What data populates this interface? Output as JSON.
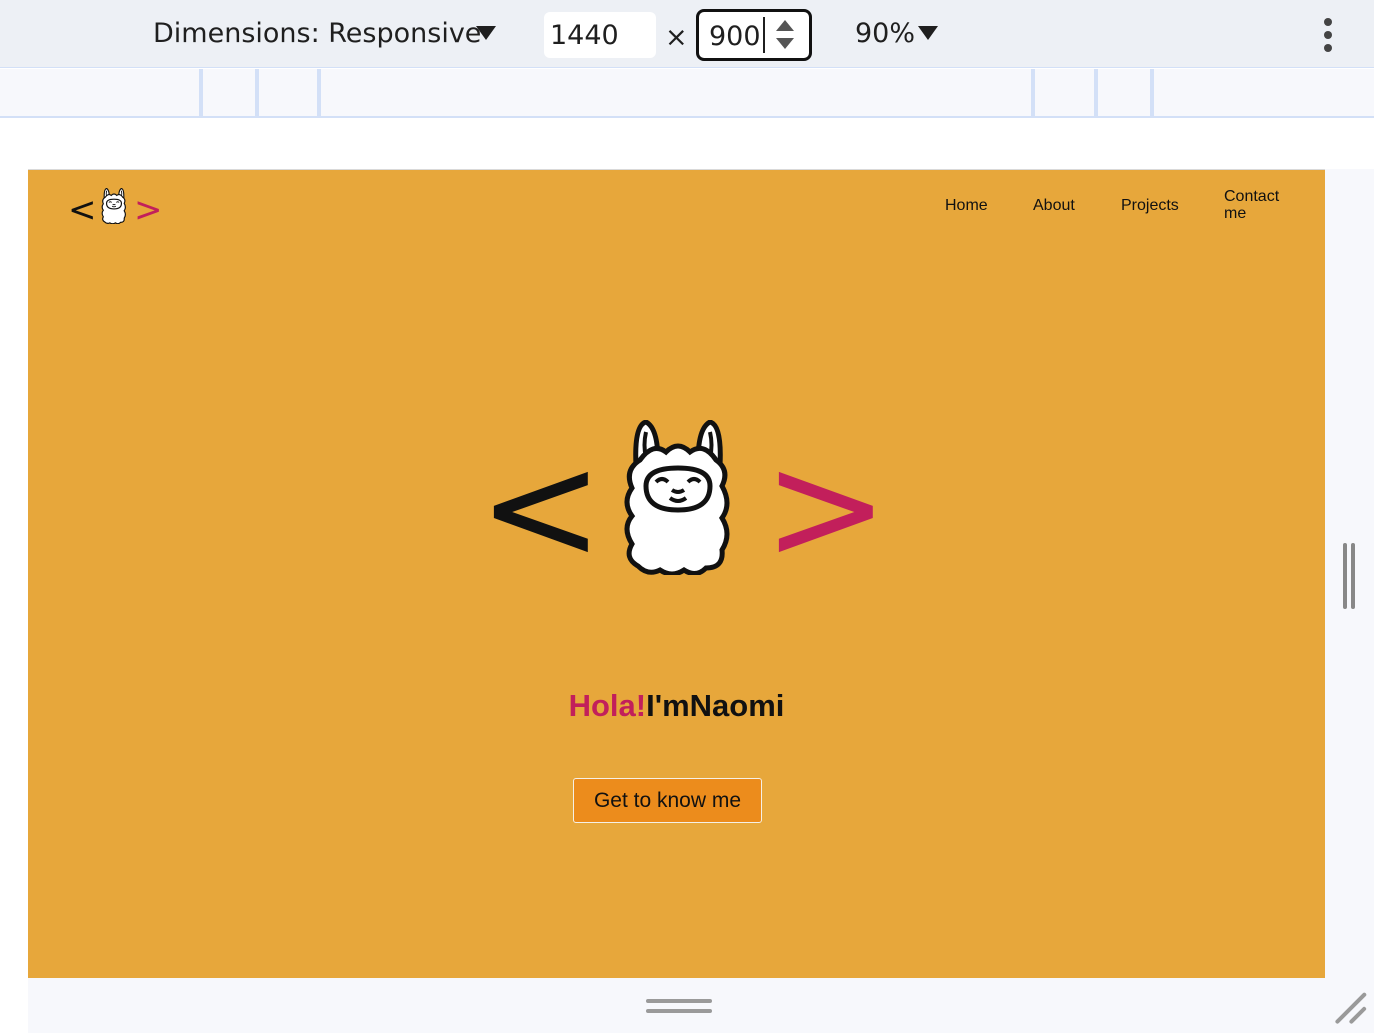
{
  "devtools": {
    "dimensions_label": "Dimensions: Responsive",
    "width_value": "1440",
    "times_symbol": "×",
    "height_value": "900",
    "zoom_label": "90%"
  },
  "site": {
    "logo": {
      "left_bracket": "<",
      "right_bracket": ">"
    },
    "nav": {
      "home": "Home",
      "about": "About",
      "projects": "Projects",
      "contact": "Contact me"
    },
    "hero": {
      "left_bracket": "<",
      "right_bracket": ">",
      "hola": "Hola!",
      "im": "I'm",
      "name": "Naomi",
      "cta_label": "Get to know me"
    }
  },
  "colors": {
    "page_background": "#e7a73b",
    "accent_magenta": "#c21f5b",
    "cta_background": "#ec8c1c",
    "toolbar_background": "#edf0f5"
  }
}
